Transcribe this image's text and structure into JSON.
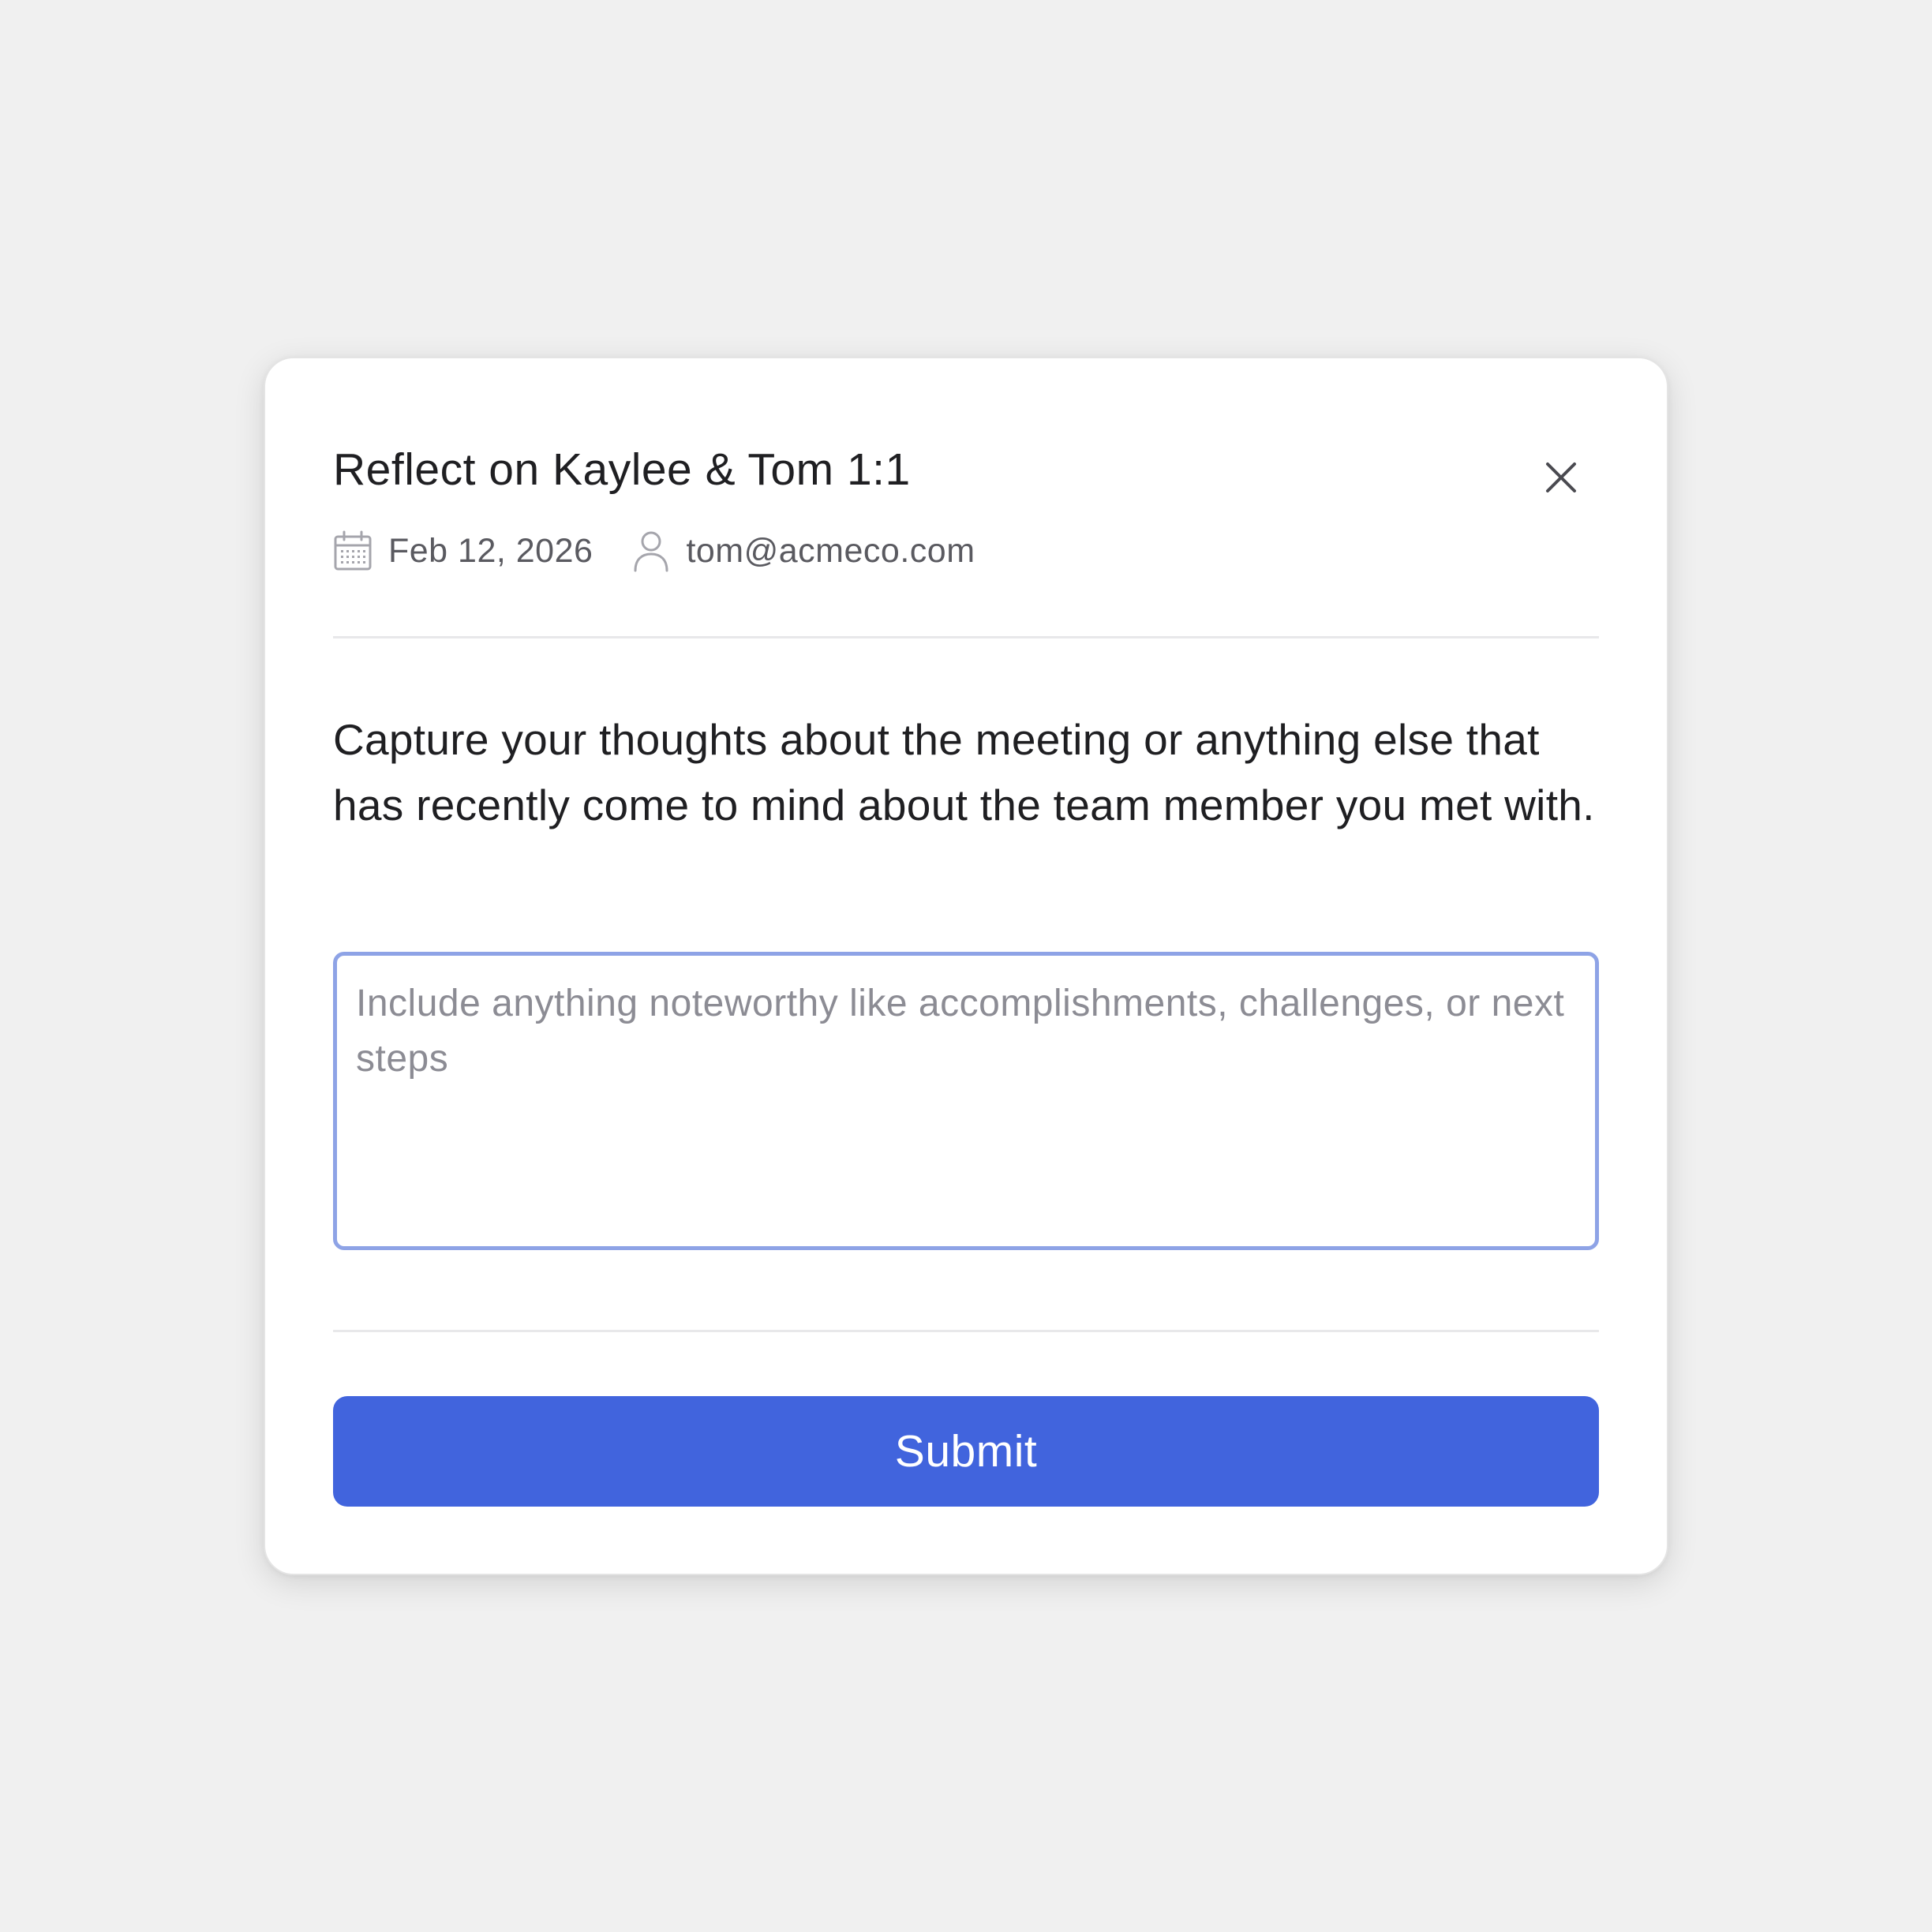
{
  "dialog": {
    "title": "Reflect on Kaylee & Tom 1:1",
    "close_icon": "close-icon",
    "meta": {
      "date_icon": "calendar-icon",
      "date": "Feb 12, 2026",
      "user_icon": "user-icon",
      "email": "tom@acmeco.com"
    },
    "prompt": "Capture your thoughts about the meeting or anything else that has recently come to mind about the team member you met with.",
    "notes": {
      "value": "",
      "placeholder": "Include anything noteworthy like accomplishments, challenges, or next steps"
    },
    "submit_label": "Submit"
  },
  "colors": {
    "background": "#f0f0f0",
    "card": "#ffffff",
    "accent": "#4164dd",
    "focus_border": "#8ea3e6",
    "text": "#1f1f22",
    "muted_text": "#5a5a60",
    "placeholder": "#8c8c94"
  }
}
